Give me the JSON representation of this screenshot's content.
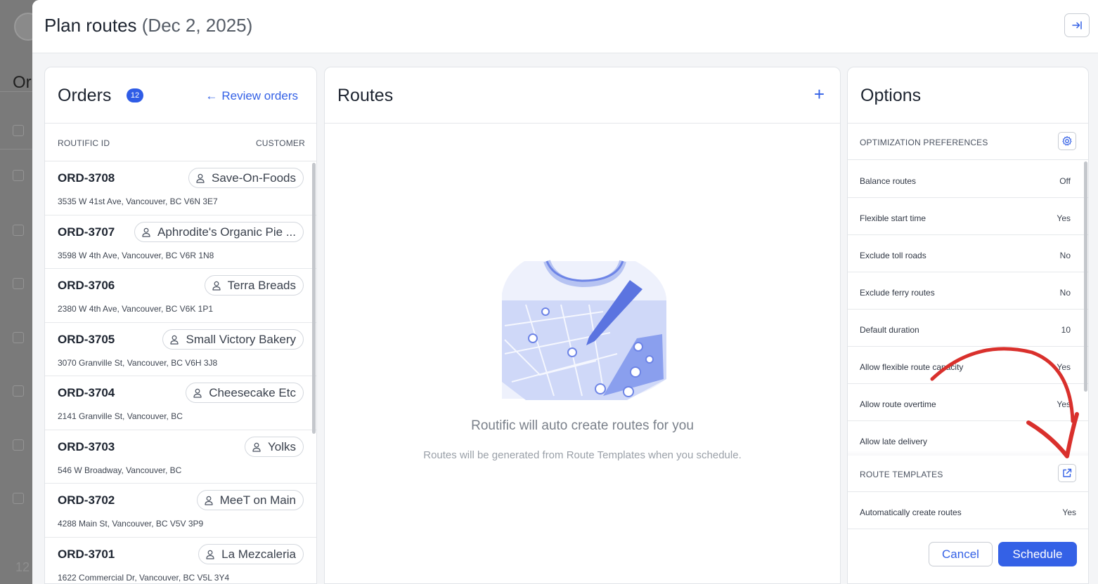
{
  "background": {
    "title_fragment": "Or",
    "page_number": "12"
  },
  "modal": {
    "title": "Plan routes",
    "date": "(Dec 2, 2025)",
    "collapse_icon": "collapse-right-icon"
  },
  "orders": {
    "title": "Orders",
    "count": "12",
    "review_link": "Review orders",
    "columns": [
      "ROUTIFIC ID",
      "CUSTOMER"
    ],
    "items": [
      {
        "id": "ORD-3708",
        "customer": "Save-On-Foods",
        "address": "3535 W 41st Ave, Vancouver, BC V6N 3E7"
      },
      {
        "id": "ORD-3707",
        "customer": "Aphrodite's Organic Pie ...",
        "address": "3598 W 4th Ave, Vancouver, BC V6R 1N8"
      },
      {
        "id": "ORD-3706",
        "customer": "Terra Breads",
        "address": "2380 W 4th Ave, Vancouver, BC V6K 1P1"
      },
      {
        "id": "ORD-3705",
        "customer": "Small Victory Bakery",
        "address": "3070 Granville St, Vancouver, BC V6H 3J8"
      },
      {
        "id": "ORD-3704",
        "customer": "Cheesecake Etc",
        "address": "2141 Granville St, Vancouver, BC"
      },
      {
        "id": "ORD-3703",
        "customer": "Yolks",
        "address": "546 W Broadway, Vancouver, BC"
      },
      {
        "id": "ORD-3702",
        "customer": "MeeT on Main",
        "address": "4288 Main St, Vancouver, BC V5V 3P9"
      },
      {
        "id": "ORD-3701",
        "customer": "La Mezcaleria",
        "address": "1622 Commercial Dr, Vancouver, BC V5L 3Y4"
      }
    ]
  },
  "routes": {
    "title": "Routes",
    "add_icon": "plus-icon",
    "empty_title": "Routific will auto create routes for you",
    "empty_subtitle": "Routes will be generated from Route Templates when you schedule."
  },
  "options": {
    "title": "Options",
    "optimization_header": "OPTIMIZATION PREFERENCES",
    "preferences": [
      {
        "name": "Balance routes",
        "value": "Off"
      },
      {
        "name": "Flexible start time",
        "value": "Yes"
      },
      {
        "name": "Exclude toll roads",
        "value": "No"
      },
      {
        "name": "Exclude ferry routes",
        "value": "No"
      },
      {
        "name": "Default duration",
        "value": "10"
      },
      {
        "name": "Allow flexible route capacity",
        "value": "Yes"
      },
      {
        "name": "Allow route overtime",
        "value": "Yes"
      },
      {
        "name": "Allow late delivery",
        "value": ""
      }
    ],
    "templates_header": "ROUTE TEMPLATES",
    "templates": [
      {
        "name": "Automatically create routes",
        "value": "Yes"
      }
    ],
    "cancel_label": "Cancel",
    "schedule_label": "Schedule"
  },
  "colors": {
    "accent": "#3461e6",
    "annotation_arrow": "#d9302c"
  }
}
